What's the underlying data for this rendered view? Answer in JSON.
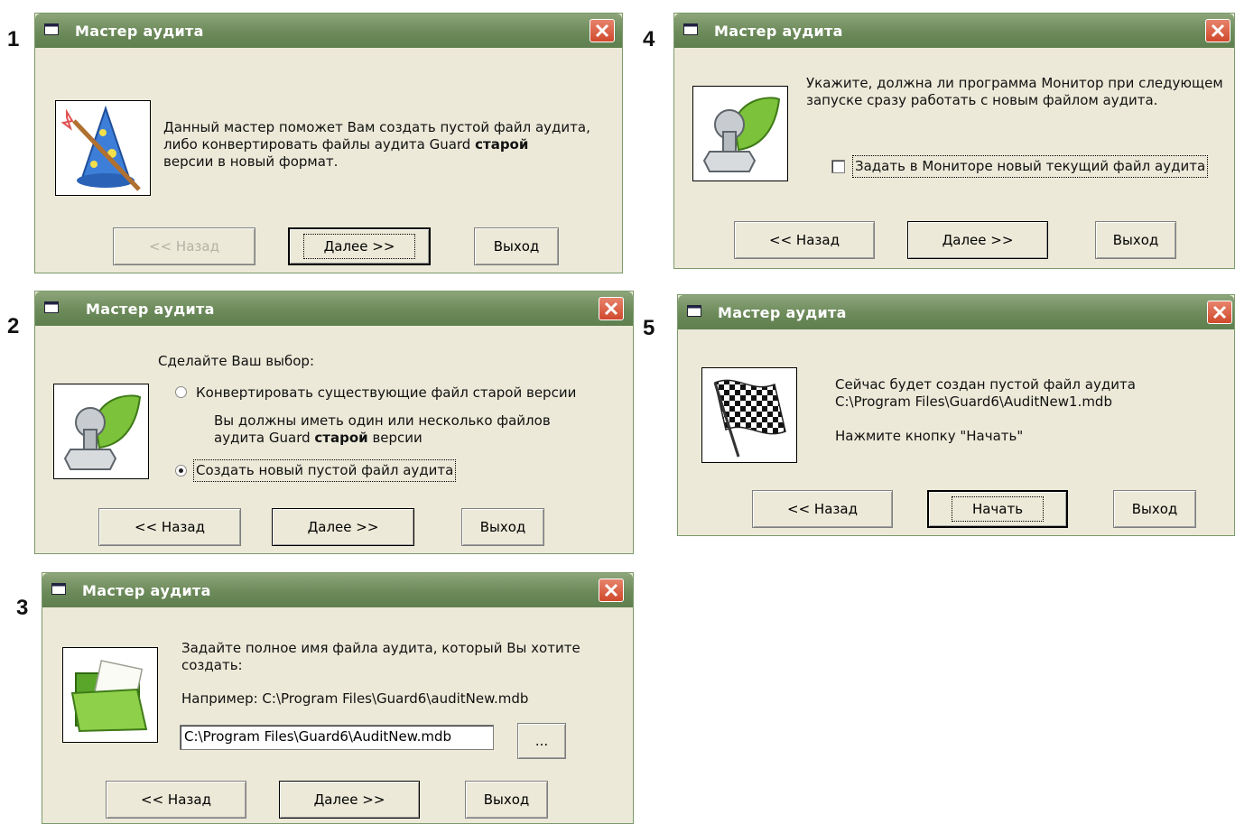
{
  "steps": [
    "1",
    "2",
    "3",
    "4",
    "5"
  ],
  "window_title": "Мастер аудита",
  "buttons": {
    "back": "<< Назад",
    "next": "Далее >>",
    "exit": "Выход",
    "start": "Начать",
    "browse": "..."
  },
  "dialog1": {
    "line1": "Данный мастер поможет Вам создать пустой файл аудита,",
    "line2": "либо конвертировать файлы аудита Guard ",
    "line2_bold": "старой",
    "line3": "версии  в новый формат."
  },
  "dialog2": {
    "prompt": "Сделайте Ваш выбор:",
    "option_convert": "Конвертировать существующие файл старой версии",
    "note_line1": "Вы должны иметь один или несколько файлов",
    "note_line2": "аудита Guard ",
    "note_bold": "старой",
    "note_line2_end": " версии",
    "option_create": "Создать новый пустой файл аудита"
  },
  "dialog3": {
    "line1": "Задайте полное имя файла аудита, который Вы хотите",
    "line2": "создать:",
    "example": "Например:   C:\\Program Files\\Guard6\\auditNew.mdb",
    "path_value": "C:\\Program Files\\Guard6\\AuditNew.mdb"
  },
  "dialog4": {
    "line1": "Укажите, должна ли программа Монитор при следующем",
    "line2": "запуске сразу работать с новым файлом аудита.",
    "checkbox_label": "Задать в Мониторе новый текущий файл аудита"
  },
  "dialog5": {
    "line1": "Сейчас будет создан пустой файл аудита",
    "line2": "C:\\Program Files\\Guard6\\AuditNew1.mdb",
    "line3": "Нажмите кнопку \"Начать\""
  }
}
